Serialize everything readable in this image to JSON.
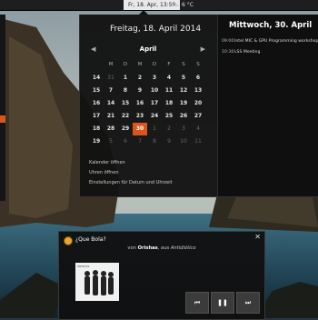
{
  "topbar": {
    "clock": "Fr, 18. Apr, 13:59",
    "weather_icon": "cloud-icon",
    "weather": "6 °C"
  },
  "calendar": {
    "date_title": "Freitag, 18. April 2014",
    "month": "April",
    "weekdays": [
      "M",
      "D",
      "M",
      "D",
      "F",
      "S",
      "S"
    ],
    "weeks": [
      {
        "num": "14",
        "days": [
          {
            "d": "31",
            "o": true
          },
          {
            "d": "1"
          },
          {
            "d": "2"
          },
          {
            "d": "3"
          },
          {
            "d": "4"
          },
          {
            "d": "5"
          },
          {
            "d": "6"
          }
        ]
      },
      {
        "num": "15",
        "days": [
          {
            "d": "7"
          },
          {
            "d": "8"
          },
          {
            "d": "9"
          },
          {
            "d": "10"
          },
          {
            "d": "11"
          },
          {
            "d": "12"
          },
          {
            "d": "13"
          }
        ]
      },
      {
        "num": "16",
        "days": [
          {
            "d": "14"
          },
          {
            "d": "15"
          },
          {
            "d": "16"
          },
          {
            "d": "17"
          },
          {
            "d": "18"
          },
          {
            "d": "19"
          },
          {
            "d": "20"
          }
        ]
      },
      {
        "num": "17",
        "days": [
          {
            "d": "21"
          },
          {
            "d": "22"
          },
          {
            "d": "23"
          },
          {
            "d": "24"
          },
          {
            "d": "25"
          },
          {
            "d": "26"
          },
          {
            "d": "27"
          }
        ]
      },
      {
        "num": "18",
        "days": [
          {
            "d": "28"
          },
          {
            "d": "29"
          },
          {
            "d": "30",
            "t": true
          },
          {
            "d": "1",
            "o": true
          },
          {
            "d": "2",
            "o": true
          },
          {
            "d": "3",
            "o": true
          },
          {
            "d": "4",
            "o": true
          }
        ]
      },
      {
        "num": "19",
        "days": [
          {
            "d": "5",
            "o": true
          },
          {
            "d": "6",
            "o": true
          },
          {
            "d": "7",
            "o": true
          },
          {
            "d": "8",
            "o": true
          },
          {
            "d": "9",
            "o": true
          },
          {
            "d": "10",
            "o": true
          },
          {
            "d": "11",
            "o": true
          }
        ]
      }
    ],
    "links": [
      "Kalender öffnen",
      "Uhren öffnen",
      "Einstellungen für Datum und Uhrzeit"
    ]
  },
  "agenda": {
    "title": "Mittwoch, 30. April",
    "events": [
      {
        "time": "09:00",
        "title": "Intel MIC & GPU Programming workshop"
      },
      {
        "time": "10:30",
        "title": "LSS Meeting"
      }
    ]
  },
  "notification": {
    "title": "¿Que Bola?",
    "by": "von",
    "artist": "Orishas",
    "from": ", aus",
    "album": "Antidiótico",
    "album_art_text": "ORISHAS",
    "close_icon": "close-icon",
    "controls": [
      {
        "name": "previous-button",
        "icon": "previous-icon"
      },
      {
        "name": "pause-button",
        "icon": "pause-icon"
      },
      {
        "name": "next-button",
        "icon": "next-icon"
      }
    ]
  },
  "colors": {
    "accent": "#d9571e",
    "panel": "#121212"
  }
}
